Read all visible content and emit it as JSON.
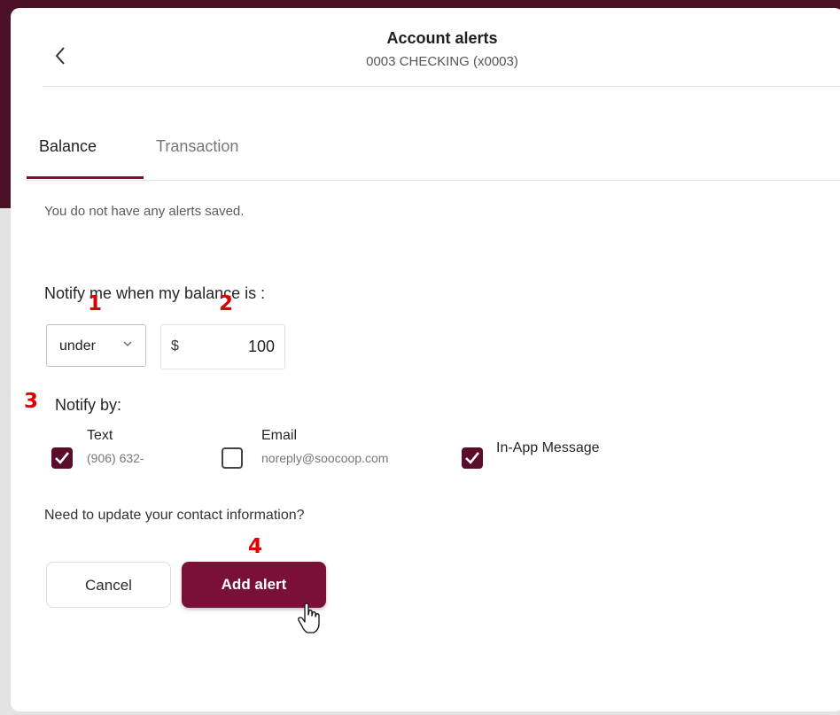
{
  "header": {
    "title": "Account alerts",
    "subtitle": "0003 CHECKING (x0003)",
    "back_icon": "chevron-left-icon"
  },
  "tabs": [
    {
      "label": "Balance",
      "active": true
    },
    {
      "label": "Transaction",
      "active": false
    }
  ],
  "empty_message": "You do not have any alerts saved.",
  "balance": {
    "label": "Notify me when my balance is :",
    "condition": "under",
    "currency_symbol": "$",
    "amount": "100"
  },
  "notify_by": {
    "label": "Notify by:",
    "options": [
      {
        "label": "Text",
        "detail": "(906) 632-",
        "checked": true
      },
      {
        "label": "Email",
        "detail": "noreply@soocoop.com",
        "checked": false
      },
      {
        "label": "In-App Message",
        "checked": true
      }
    ]
  },
  "contact_link": "Need to update your contact information?",
  "buttons": {
    "cancel": "Cancel",
    "add": "Add alert"
  },
  "annotations": [
    "1",
    "2",
    "3",
    "4"
  ],
  "colors": {
    "accent": "#7a0f38",
    "checkbox": "#5a0d2b",
    "marker": "#e00000",
    "top_bar": "#4a1127"
  }
}
